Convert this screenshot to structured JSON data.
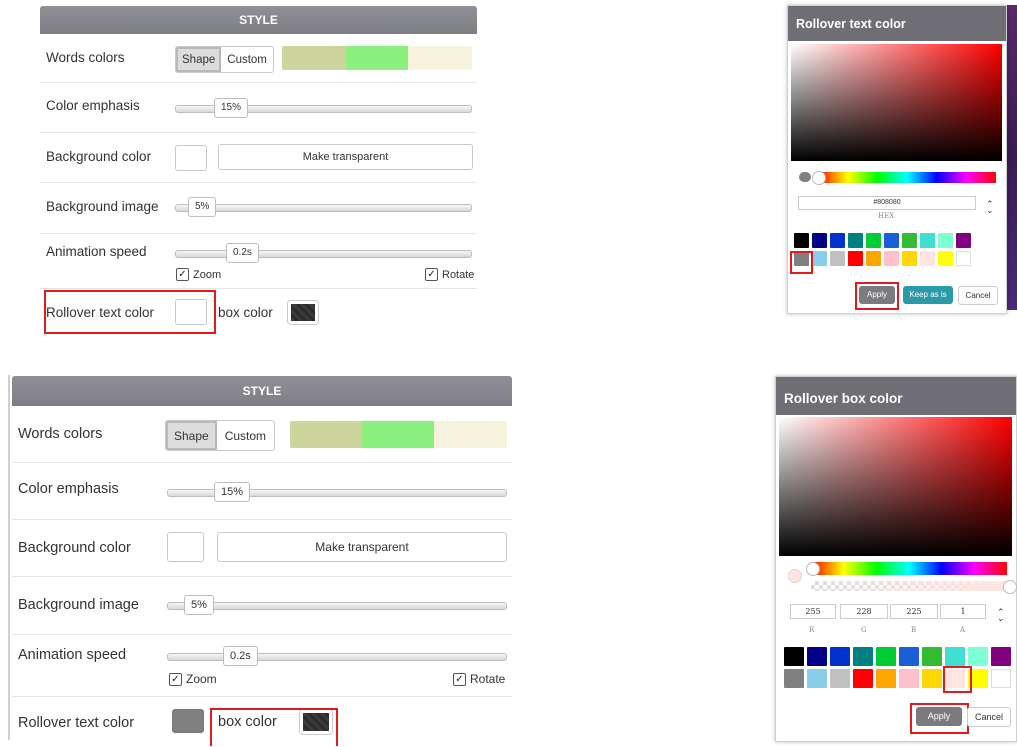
{
  "panel_top": {
    "header": "STYLE",
    "words_colors": {
      "label": "Words colors",
      "shape": "Shape",
      "custom": "Custom",
      "palette": [
        "#cdd59d",
        "#8cf07f",
        "#f5f3dc"
      ]
    },
    "color_emphasis": {
      "label": "Color emphasis",
      "value": "15%"
    },
    "background_color": {
      "label": "Background color",
      "transparent_button": "Make transparent"
    },
    "background_image": {
      "label": "Background image",
      "value": "5%"
    },
    "animation_speed": {
      "label": "Animation speed",
      "value": "0.2s",
      "zoom": "Zoom",
      "rotate": "Rotate"
    },
    "rollover": {
      "text_label": "Rollover text color",
      "box_label": "box color",
      "text_swatch": "#ffffff"
    }
  },
  "panel_bottom": {
    "header": "STYLE",
    "words_colors": {
      "label": "Words colors",
      "shape": "Shape",
      "custom": "Custom",
      "palette": [
        "#cdd59d",
        "#8cf07f",
        "#f5f3dc"
      ]
    },
    "color_emphasis": {
      "label": "Color emphasis",
      "value": "15%"
    },
    "background_color": {
      "label": "Background color",
      "transparent_button": "Make transparent"
    },
    "background_image": {
      "label": "Background image",
      "value": "5%"
    },
    "animation_speed": {
      "label": "Animation speed",
      "value": "0.2s",
      "zoom": "Zoom",
      "rotate": "Rotate"
    },
    "rollover": {
      "text_label": "Rollover text color",
      "box_label": "box color",
      "text_swatch": "#808080"
    }
  },
  "dialog_text": {
    "title": "Rollover text color",
    "hex_value": "#808080",
    "hex_label": "HEX",
    "apply": "Apply",
    "keep": "Keep as is",
    "cancel": "Cancel",
    "swatches": [
      "#000000",
      "#00008b",
      "#0033cc",
      "#008080",
      "#00cc33",
      "#1a5fd6",
      "#33bb33",
      "#40e0d0",
      "#7fffd4",
      "#800080",
      "#808080",
      "#87ceeb",
      "#c0c0c0",
      "#ff0000",
      "#ffa500",
      "#ffc0cb",
      "#ffd700",
      "#ffe4e1",
      "#ffff00",
      "#ffffff"
    ]
  },
  "dialog_box": {
    "title": "Rollover box color",
    "r": "255",
    "g": "228",
    "b": "225",
    "a": "1",
    "r_label": "R",
    "g_label": "G",
    "b_label": "B",
    "a_label": "A",
    "apply": "Apply",
    "cancel": "Cancel",
    "swatches": [
      "#000000",
      "#00008b",
      "#0033cc",
      "#008080",
      "#00cc33",
      "#1a5fd6",
      "#33bb33",
      "#40e0d0",
      "#7fffd4",
      "#800080",
      "#808080",
      "#87ceeb",
      "#c0c0c0",
      "#ff0000",
      "#ffa500",
      "#ffc0cb",
      "#ffd700",
      "#ffe4e1",
      "#ffff00",
      "#ffffff"
    ]
  },
  "colors": {
    "highlight": "#e11b1b",
    "header": "#838389"
  }
}
